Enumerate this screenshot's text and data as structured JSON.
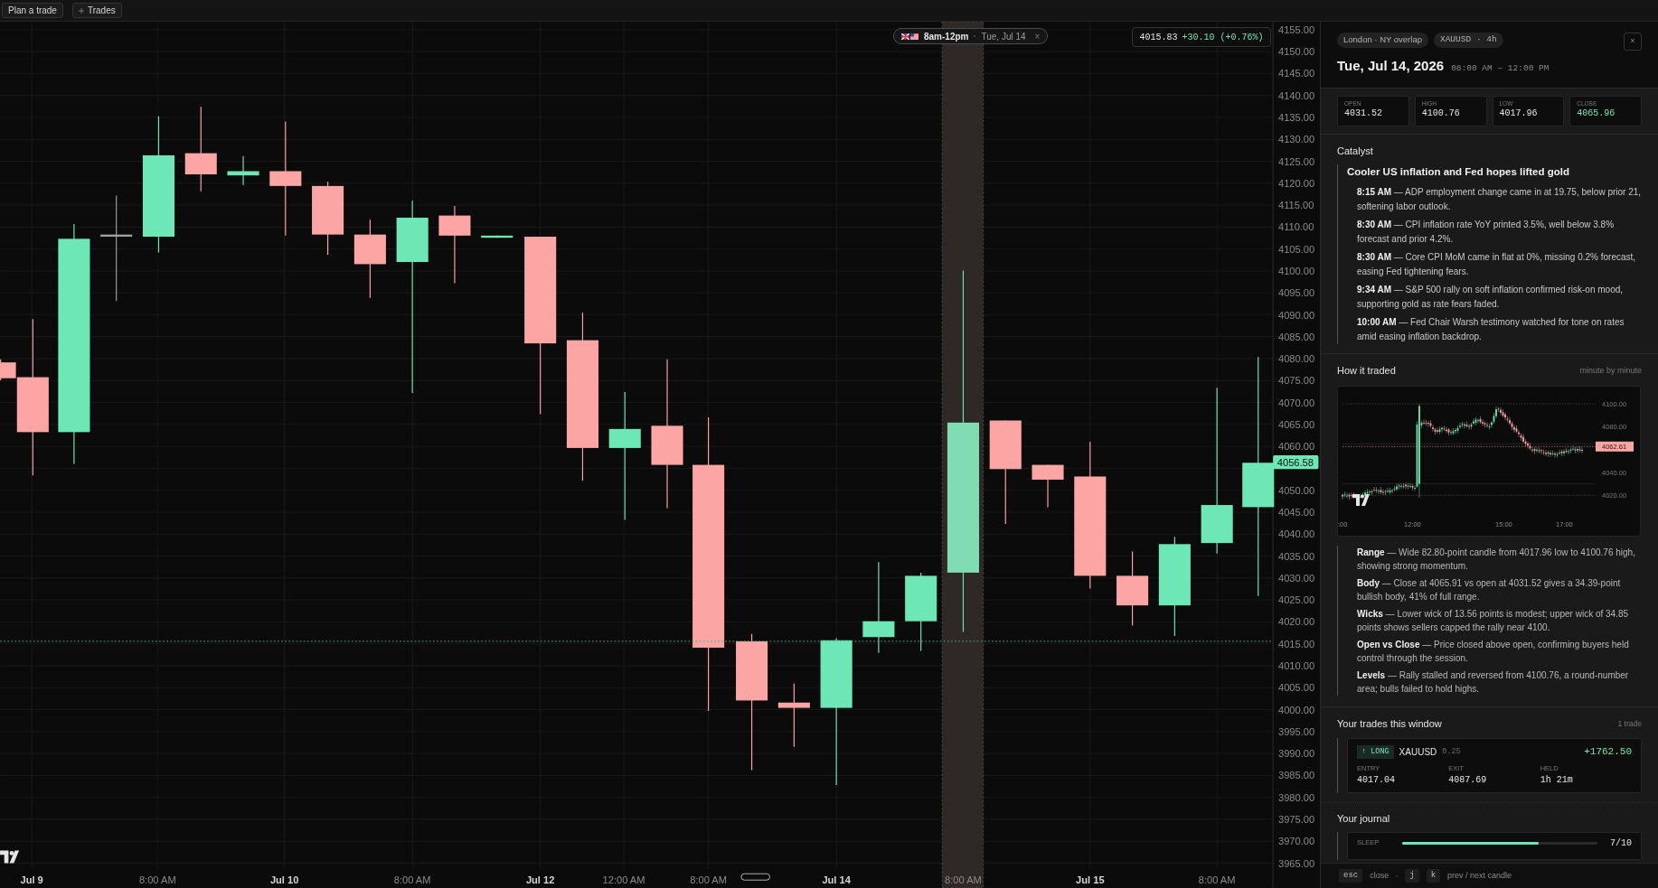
{
  "top_bar": {
    "buttons": [
      {
        "label": "Plan a trade",
        "kind": "text"
      },
      {
        "label": "Trades",
        "kind": "plus"
      }
    ]
  },
  "chart": {
    "session_pill": {
      "hours": "8am-12pm",
      "date": "Tue, Jul 14",
      "close": "×"
    },
    "quote": {
      "price": "4015.83",
      "change": "+30.10 (+0.76%)"
    },
    "price_tag": "4056.58",
    "y_axis_labels": [
      "4155.00",
      "4150.00",
      "4145.00",
      "4140.00",
      "4135.00",
      "4130.00",
      "4125.00",
      "4120.00",
      "4115.00",
      "4110.00",
      "4105.00",
      "4100.00",
      "4095.00",
      "4090.00",
      "4085.00",
      "4080.00",
      "4075.00",
      "4070.00",
      "4065.00",
      "4060.00",
      "4050.00",
      "4045.00",
      "4040.00",
      "4035.00",
      "4030.00",
      "4025.00",
      "4020.00",
      "4015.00",
      "4010.00",
      "4005.00",
      "4000.00",
      "3995.00",
      "3990.00",
      "3985.00",
      "3980.00",
      "3975.00",
      "3970.00",
      "3965.00"
    ],
    "x_axis_labels": [
      {
        "text": "Jul 9",
        "kind": "day"
      },
      {
        "text": "8:00 AM",
        "kind": "time"
      },
      {
        "text": "Jul 10",
        "kind": "day"
      },
      {
        "text": "8:00 AM",
        "kind": "time"
      },
      {
        "text": "Jul 12",
        "kind": "day"
      },
      {
        "text": "12:00 AM",
        "kind": "time"
      },
      {
        "text": "8:00 AM",
        "kind": "time"
      },
      {
        "text": "Jul 14",
        "kind": "day"
      },
      {
        "text": "8:00 AM",
        "kind": "time"
      },
      {
        "text": "Jul 15",
        "kind": "day"
      },
      {
        "text": "8:00 AM",
        "kind": "time"
      }
    ]
  },
  "panel": {
    "chips": [
      "London · NY overlap",
      "XAUUSD · 4h"
    ],
    "close": "×",
    "date": "Tue, Jul 14, 2026",
    "time_range": "08:00 AM – 12:00 PM",
    "stats": [
      {
        "label": "OPEN",
        "value": "4031.52",
        "color": "#e5e5e5"
      },
      {
        "label": "HIGH",
        "value": "4100.76",
        "color": "#e5e5e5"
      },
      {
        "label": "LOW",
        "value": "4017.96",
        "color": "#e5e5e5"
      },
      {
        "label": "CLOSE",
        "value": "4065.96",
        "color": "#6ee7b7"
      }
    ],
    "catalyst": {
      "heading": "Catalyst",
      "title": "Cooler US inflation and Fed hopes lifted gold",
      "events": [
        "**8:15 AM** — ADP employment change came in at 19.75, below prior 21, softening labor outlook.",
        "**8:30 AM** — CPI inflation rate YoY printed 3.5%, well below 3.8% forecast and prior 4.2%.",
        "**8:30 AM** — Core CPI MoM came in flat at 0%, missing 0.2% forecast, easing Fed tightening fears.",
        "**9:34 AM** — S&P 500 rally on soft inflation confirmed risk-on mood, supporting gold as rate fears faded.",
        "**10:00 AM** — Fed Chair Warsh testimony watched for tone on rates amid easing inflation backdrop."
      ]
    },
    "how_it_traded": {
      "heading": "How it traded",
      "note": "minute by minute",
      "mini_chart": {
        "y_labels": [
          "4100.00",
          "4080.00",
          "4040.00",
          "4020.00"
        ],
        "price_tag": "4062.61",
        "x_labels": [
          ":00",
          "12:00",
          "15:00",
          "17:00"
        ]
      },
      "notes": [
        "**Range** — Wide 82.80-point candle from 4017.96 low to 4100.76 high, showing strong momentum.",
        "**Body** — Close at 4065.91 vs open at 4031.52 gives a 34.39-point bullish body, 41% of full range.",
        "**Wicks** — Lower wick of 13.56 points is modest; upper wick of 34.85 points shows sellers capped the rally near 4100.",
        "**Open vs Close** — Price closed above open, confirming buyers held control through the session.",
        "**Levels** — Rally stalled and reversed from 4100.76, a round-number area; bulls failed to hold highs."
      ]
    },
    "trades": {
      "heading": "Your trades this window",
      "count": "1 trade",
      "items": [
        {
          "direction": "↑ LONG",
          "symbol": "XAUUSD",
          "size": "0.25",
          "pnl": "+1762.50",
          "fields": [
            {
              "label": "ENTRY",
              "value": "4017.04"
            },
            {
              "label": "EXIT",
              "value": "4087.69"
            },
            {
              "label": "HELD",
              "value": "1h 21m"
            }
          ]
        }
      ]
    },
    "journal": {
      "heading": "Your journal",
      "rows": [
        {
          "label": "SLEEP",
          "level": 0.7,
          "reading": "7/10"
        }
      ]
    }
  },
  "footer": [
    {
      "keys": [
        "esc"
      ],
      "label": "close"
    },
    {
      "keys": [
        "j",
        "k"
      ],
      "label": "prev / next candle"
    }
  ]
}
